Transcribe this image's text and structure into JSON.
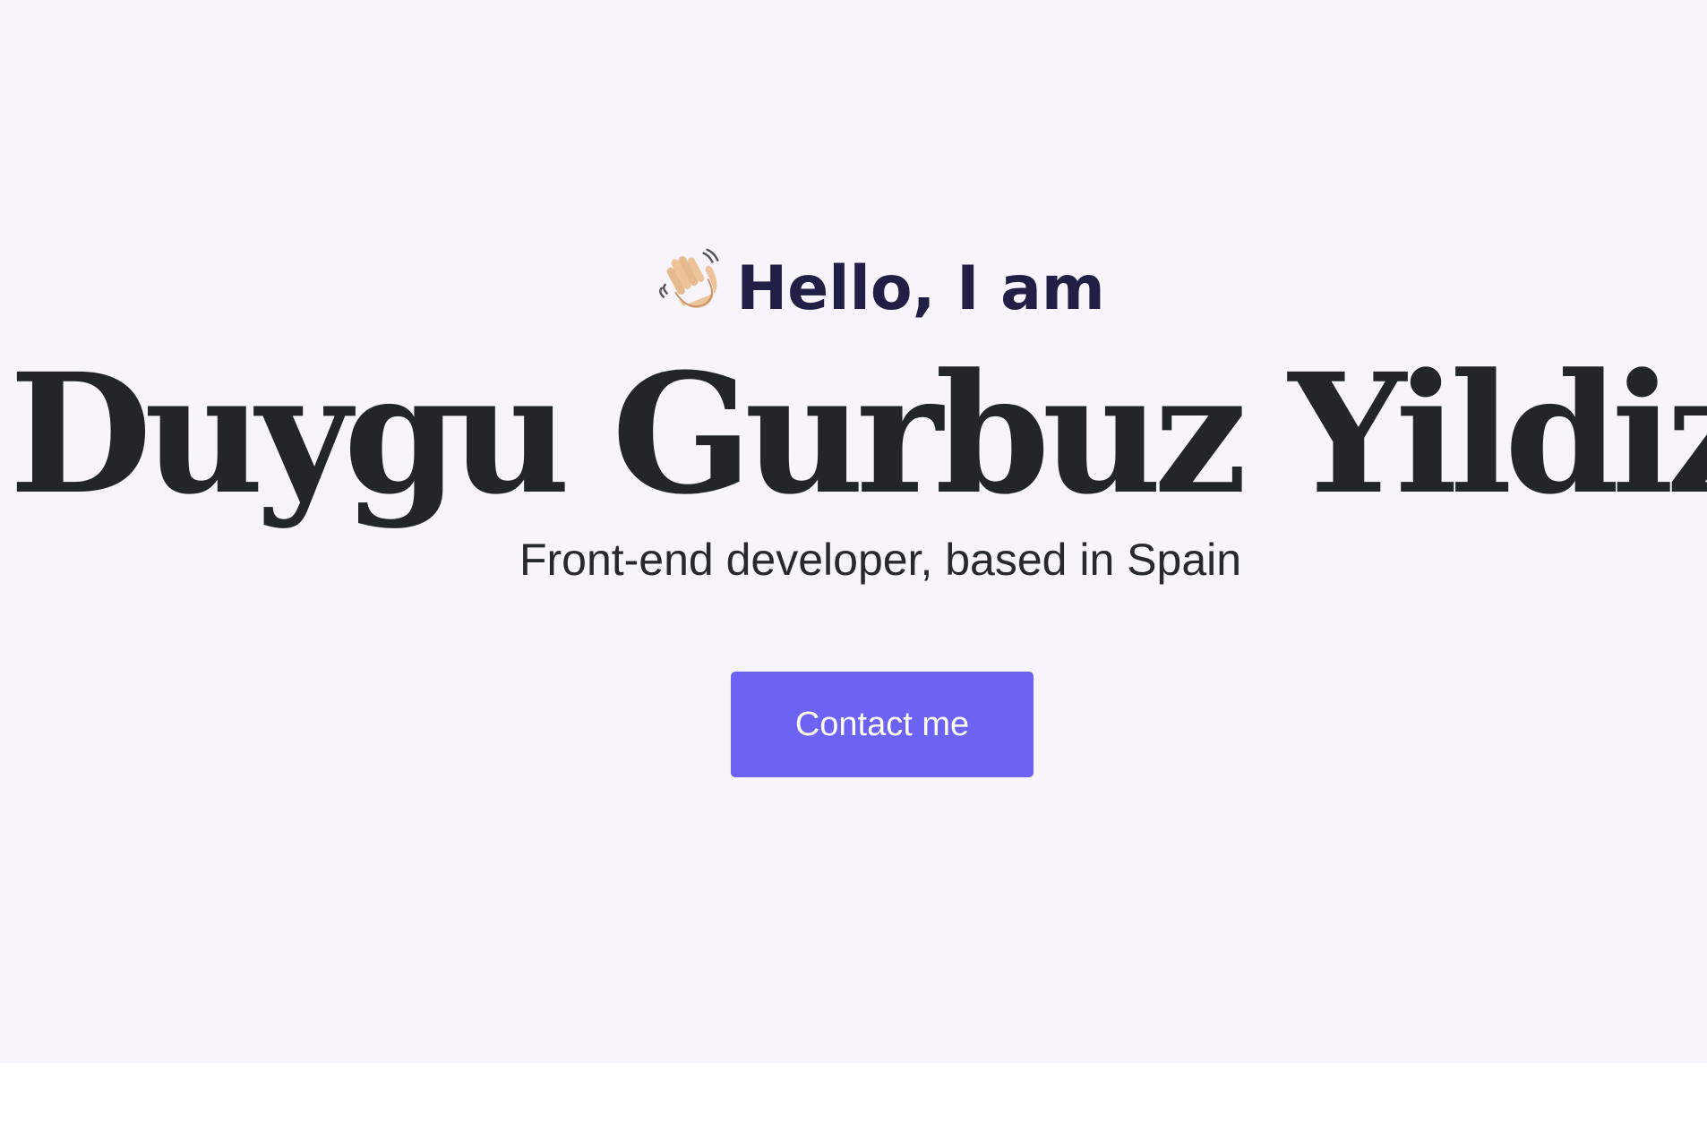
{
  "hero": {
    "greeting": "Hello, I am",
    "wave_icon": "waving-hand-icon",
    "name": "Duygu Gurbuz Yildiz",
    "subtitle": "Front-end developer, based in Spain",
    "contact_label": "Contact me"
  },
  "colors": {
    "background": "#f7f5fb",
    "heading": "#211f45",
    "name": "#22262a",
    "button": "#6c63f5",
    "button_text": "#ffffff"
  }
}
